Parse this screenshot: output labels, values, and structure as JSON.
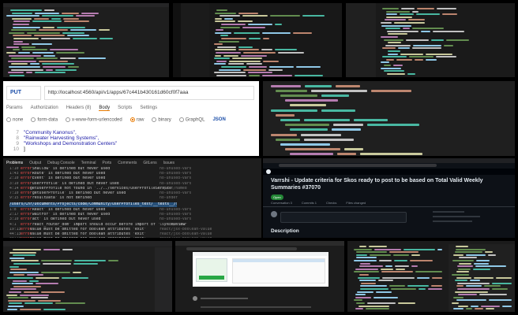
{
  "postman": {
    "method": "PUT",
    "url": "http://localhost:4560/api/v1/apps/67c441b430161d60cf0f7aaa",
    "tabs": [
      "Params",
      "Authorization",
      "Headers (8)",
      "Body",
      "Scripts",
      "Settings"
    ],
    "active_tab": "Body",
    "body_types": [
      "none",
      "form-data",
      "x-www-form-urlencoded",
      "raw",
      "binary",
      "GraphQL"
    ],
    "selected_body_type": "raw",
    "format": "JSON",
    "body_lines": [
      {
        "n": "7",
        "text": "\"Community Kanonus\","
      },
      {
        "n": "8",
        "text": "\"Rainwater Harvesting Systems\","
      },
      {
        "n": "9",
        "text": "\"Workshops and Demonstration Centers\""
      },
      {
        "n": "10",
        "text": "]"
      }
    ]
  },
  "errors": {
    "tabs": [
      "Problems",
      "Output",
      "Debug Console",
      "Terminal",
      "Ports",
      "Comments",
      "GitLens",
      "Issues"
    ],
    "rows": [
      {
        "n": "1:10",
        "lvl": "error",
        "msg": "'Shallow' is defined but never used",
        "rule": "no-unused-vars"
      },
      {
        "n": "1:43",
        "lvl": "error",
        "msg": "'Route' is defined but never used",
        "rule": "no-unused-vars"
      },
      {
        "n": "2:10",
        "lvl": "error",
        "msg": "'Event' is defined but never used",
        "rule": "no-unused-vars"
      },
      {
        "n": "3:10",
        "lvl": "error",
        "msg": "'userProfile' is defined but never used",
        "rule": "no-unused-vars"
      },
      {
        "n": "4:14",
        "lvl": "error",
        "msg": "getUserProfile not found in '../../services/userProfileService'",
        "rule": "import/named"
      },
      {
        "n": "7:10",
        "lvl": "error",
        "msg": "'getUserProfile' is defined but never used",
        "rule": "no-unused-vars"
      },
      {
        "n": "9:15",
        "lvl": "error",
        "msg": "'resultData' is not defined",
        "rule": "no-undef"
      }
    ],
    "path": "/Users/Chr/Documents/Projects/code/Community/userProfiles_test/__tests__/someView.test.js",
    "rows2": [
      {
        "n": "1:8",
        "lvl": "error",
        "msg": "'React' is defined but never used",
        "rule": "no-unused-vars"
      },
      {
        "n": "2:17",
        "lvl": "error",
        "msg": "'waitFor' is defined but never used",
        "rule": "no-unused-vars"
      },
      {
        "n": "3:10",
        "lvl": "error",
        "msg": "'act' is defined but never used",
        "rule": "no-unused-vars"
      },
      {
        "n": "4:1",
        "lvl": "error",
        "msg": "'react_router_dom' import should occur before import of '../someView'",
        "rule": "import/order"
      },
      {
        "n": "19:13",
        "lvl": "error",
        "msg": "Value must be omitted for boolean attributes 'exit'",
        "rule": "react/jsx-boolean-value"
      },
      {
        "n": "44:13",
        "lvl": "error",
        "msg": "Value must be omitted for boolean attributes 'exit'",
        "rule": "react/jsx-boolean-value"
      },
      {
        "n": "44:13",
        "lvl": "error",
        "msg": "Value must be omitted for boolean attributes 'exit'",
        "rule": "react/jsx-boolean-value"
      }
    ]
  },
  "github": {
    "title": "Varrshi - Update criteria for Skos ready to post to be based on Total Valid Weekly Summaries #37070",
    "badge": "Open",
    "description_heading": "Description",
    "tabs": [
      "Conversation 3",
      "Commits 1",
      "Checks",
      "Files changed"
    ]
  },
  "colors": {
    "keyword": "#c586c0",
    "variable": "#9cdcfe",
    "string": "#ce9178",
    "function": "#dcdcaa",
    "comment": "#6a9955",
    "type": "#4ec9b0",
    "accent_orange": "#e97b00",
    "error_red": "#f14c4c"
  }
}
